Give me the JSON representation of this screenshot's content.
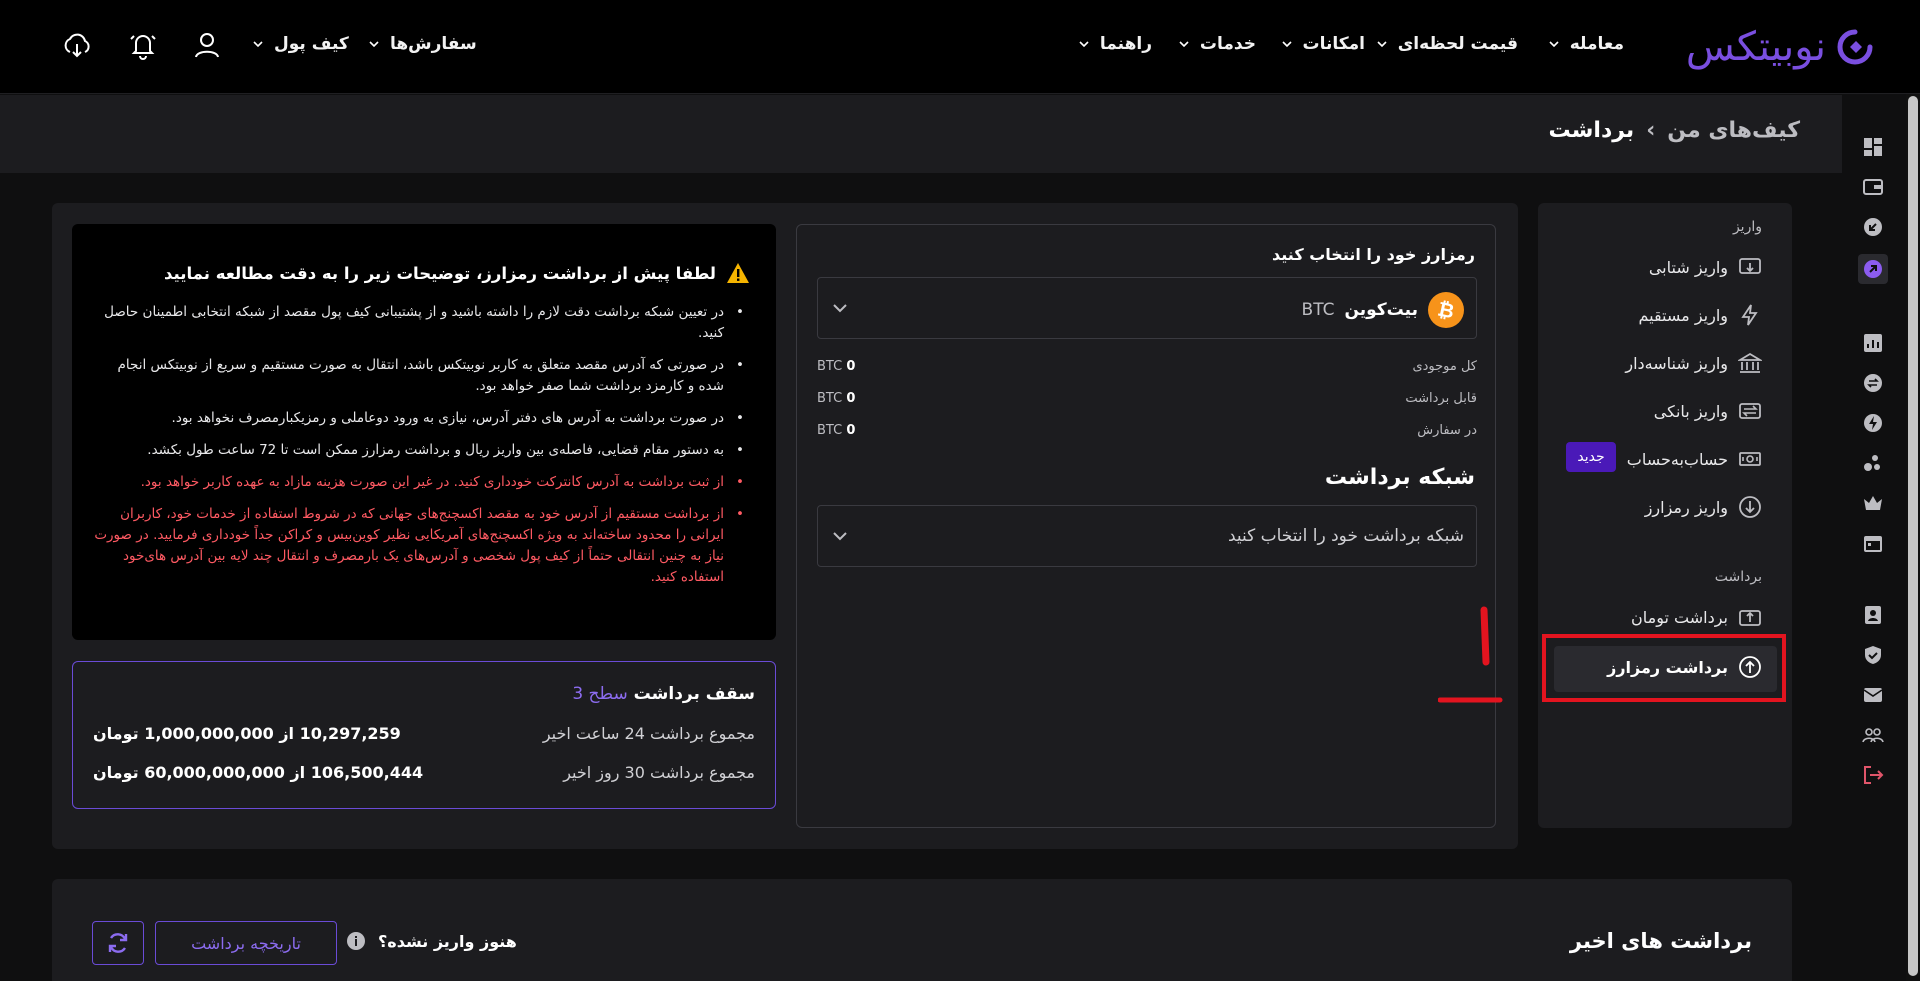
{
  "brand": {
    "logo_text": "نوبیتکس",
    "accent": "#7a4fe0"
  },
  "topnav": {
    "items": [
      {
        "label": "معامله"
      },
      {
        "label": "قیمت لحظه‌ای"
      },
      {
        "label": "امکانات"
      },
      {
        "label": "خدمات"
      },
      {
        "label": "راهنما"
      }
    ],
    "left_items": [
      {
        "label": "سفارش‌ها"
      },
      {
        "label": "کیف پول"
      }
    ]
  },
  "breadcrumb": {
    "parent": "کیف‌های من",
    "separator": "›",
    "current": "برداشت"
  },
  "sidemenu": {
    "deposit_header": "واریز",
    "deposit_items": [
      {
        "label": "واریز شتابی"
      },
      {
        "label": "واریز مستقیم"
      },
      {
        "label": "واریز شناسه‌دار"
      },
      {
        "label": "واریز بانکی"
      },
      {
        "label": "حساب‌به‌حساب",
        "badge": "جدید"
      },
      {
        "label": "واریز رمزارز"
      }
    ],
    "withdraw_header": "برداشت",
    "withdraw_items": [
      {
        "label": "برداشت تومان"
      },
      {
        "label": "برداشت رمزارز"
      }
    ]
  },
  "select": {
    "title": "رمزارز خود را انتخاب کنید",
    "coin_name": "بیت‌کوین",
    "coin_symbol": "BTC",
    "balances": [
      {
        "label": "کل موجودی",
        "value": "0",
        "unit": "BTC"
      },
      {
        "label": "قابل برداشت",
        "value": "0",
        "unit": "BTC"
      },
      {
        "label": "در سفارش",
        "value": "0",
        "unit": "BTC"
      }
    ],
    "network_title": "شبکه برداشت",
    "network_placeholder": "شبکه برداشت خود را انتخاب کنید"
  },
  "warning": {
    "title": "لطفا پیش از برداشت رمزارز، توضیحات زیر را به دقت مطالعه نمایید",
    "items": [
      {
        "text": "در تعیین شبکه برداشت دقت لازم را داشته باشید و از پشتیبانی کیف پول مقصد از شبکه انتخابی اطمینان حاصل کنید.",
        "red": false
      },
      {
        "text": "در صورتی که آدرس مقصد متعلق به کاربر نوبیتکس باشد، انتقال به صورت مستقیم و سریع از نوبیتکس انجام شده و کارمزد برداشت شما صفر خواهد بود.",
        "red": false
      },
      {
        "text": "در صورت برداشت به آدرس های دفتر آدرس، نیازی به ورود دوعاملی و رمزیکبارمصرف نخواهد بود.",
        "red": false
      },
      {
        "text": "به دستور مقام قضایی، فاصله‌ی بین واریز ریال و برداشت رمزارز ممکن است تا 72 ساعت طول بکشد.",
        "red": false
      },
      {
        "text": "از ثبت برداشت به آدرس کانترکت خودداری کنید. در غیر این صورت هزینه مازاد به عهده کاربر خواهد بود.",
        "red": true
      },
      {
        "text": "از برداشت مستقیم از آدرس خود به مقصد اکسچنج‌های جهانی که در شروط استفاده از خدمات خود، کاربران ایرانی را محدود ساخته‌اند به ویژه اکسچنج‌های آمریکایی نظیر کوین‌بیس و کراکن جداً خودداری فرمایید. در صورت نیاز به چنین انتقالی حتماً از کیف پول شخصی و آدرس‌های یک بارمصرف و انتقال چند لایه بین آدرس های‌خود استفاده کنید.",
        "red": true
      }
    ]
  },
  "limits": {
    "title": "سقف برداشت",
    "level": "سطح 3",
    "rows": [
      {
        "label": "مجموع برداشت 24 ساعت اخیر",
        "value": "10,297,259 از 1,000,000,000 تومان"
      },
      {
        "label": "مجموع برداشت 30 روز اخیر",
        "value": "106,500,444 از 60,000,000,000 تومان"
      }
    ]
  },
  "recent": {
    "title": "برداشت های اخیر",
    "not_deposited": "هنوز واریز نشده؟",
    "history_button": "تاریخچه برداشت"
  },
  "annotation": {
    "mark": "1",
    "color": "#e3141f"
  }
}
